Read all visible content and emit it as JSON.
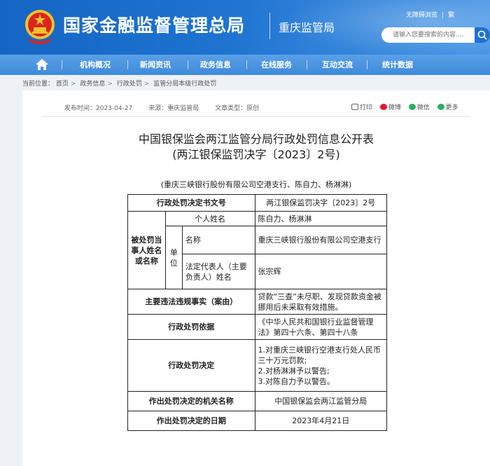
{
  "header": {
    "site_title": "国家金融监督管理总局",
    "sub_title": "重庆监管局",
    "links": [
      "无障碍浏览",
      "繁"
    ],
    "search_placeholder": "请输入您要搜索的内容...."
  },
  "nav": {
    "items": [
      "机构概况",
      "新闻资讯",
      "政务信息",
      "在线服务",
      "互动交流",
      "统计数据"
    ]
  },
  "breadcrumb": {
    "label": "当前位置：",
    "items": [
      "首页",
      "政务信息",
      "行政处罚",
      "监管分局本级行政处罚"
    ]
  },
  "meta": {
    "publish": "发布时间：2023-04-27",
    "source": "来源：重庆监管局",
    "type": "文章类型：原创"
  },
  "share": [
    "打印",
    "微博",
    "微信",
    "更多"
  ],
  "document": {
    "title_line1": "中国银保监会两江监管分局行政处罚信息公开表",
    "title_line2": "(两江银保监罚决字〔2023〕2号)",
    "subtitle": "(重庆三峡银行股份有限公司空港支行、陈自力、杨淋淋)"
  },
  "table": {
    "doc_no_label": "行政处罚决定书文号",
    "doc_no_value": "两江银保监罚决字〔2023〕2号",
    "party_label": "被处罚当事人姓名或名称",
    "person_label": "个人姓名",
    "person_value": "陈自力、杨淋淋",
    "unit_label": "单位",
    "name_label": "名称",
    "name_value": "重庆三峡银行股份有限公司空港支行",
    "rep_label": "法定代表人（主要负责人）姓名",
    "rep_value": "张宗辉",
    "facts_label": "主要违法违规事实（案由）",
    "facts_value": "贷款“三查”未尽职、发现贷款资金被挪用后未采取有效措施。",
    "basis_label": "行政处罚依据",
    "basis_value": "《中华人民共和国银行业监督管理法》第四十六条、第四十八条",
    "decision_label": "行政处罚决定",
    "decision_lines": [
      "1.对重庆三峡银行空港支行处人民币三十万元罚款;",
      "2.对杨淋淋予以警告;",
      "3.对陈自力予以警告。"
    ],
    "authority_label": "作出处罚决定的机关名称",
    "authority_value": "中国银保监会两江监管分局",
    "date_label": "作出处罚决定的日期",
    "date_value": "2023年4月21日"
  },
  "colors": {
    "header_blue": "#1e73d0",
    "nav_blue": "#4a92dd",
    "emblem_red": "#d9261c",
    "emblem_gold": "#f2c230",
    "weibo": "#e6162d",
    "wechat": "#2aae67"
  }
}
